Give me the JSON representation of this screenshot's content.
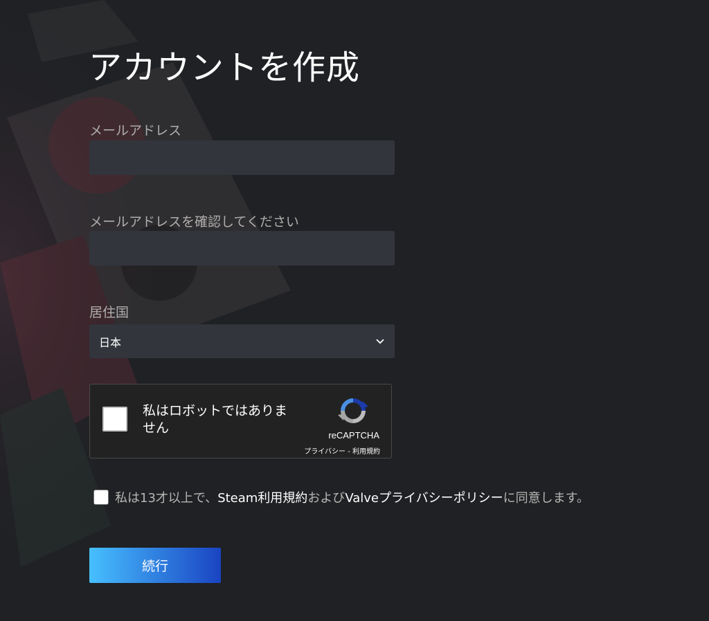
{
  "page": {
    "title": "アカウントを作成"
  },
  "form": {
    "email_label": "メールアドレス",
    "email_value": "",
    "confirm_email_label": "メールアドレスを確認してください",
    "confirm_email_value": "",
    "country_label": "居住国",
    "country_value": "日本"
  },
  "recaptcha": {
    "label": "私はロボットではありません",
    "brand": "reCAPTCHA",
    "privacy_link": "プライバシー",
    "separator": " - ",
    "terms_link": "利用規約",
    "checked": false
  },
  "agreement": {
    "checked": false,
    "text_prefix": "私は13才以上で、",
    "steam_terms_link": "Steam利用規約",
    "text_and": "および",
    "privacy_link": "Valveプライバシーポリシー",
    "text_suffix": "に同意します。"
  },
  "buttons": {
    "continue_label": "続行"
  },
  "icons": {
    "select": "chevron-down-icon",
    "recaptcha": "recaptcha-logo-icon"
  },
  "colors": {
    "background": "#1f2124",
    "input_background": "#32353c",
    "button_gradient_start": "#47bfff",
    "button_gradient_end": "#1a44c2"
  }
}
